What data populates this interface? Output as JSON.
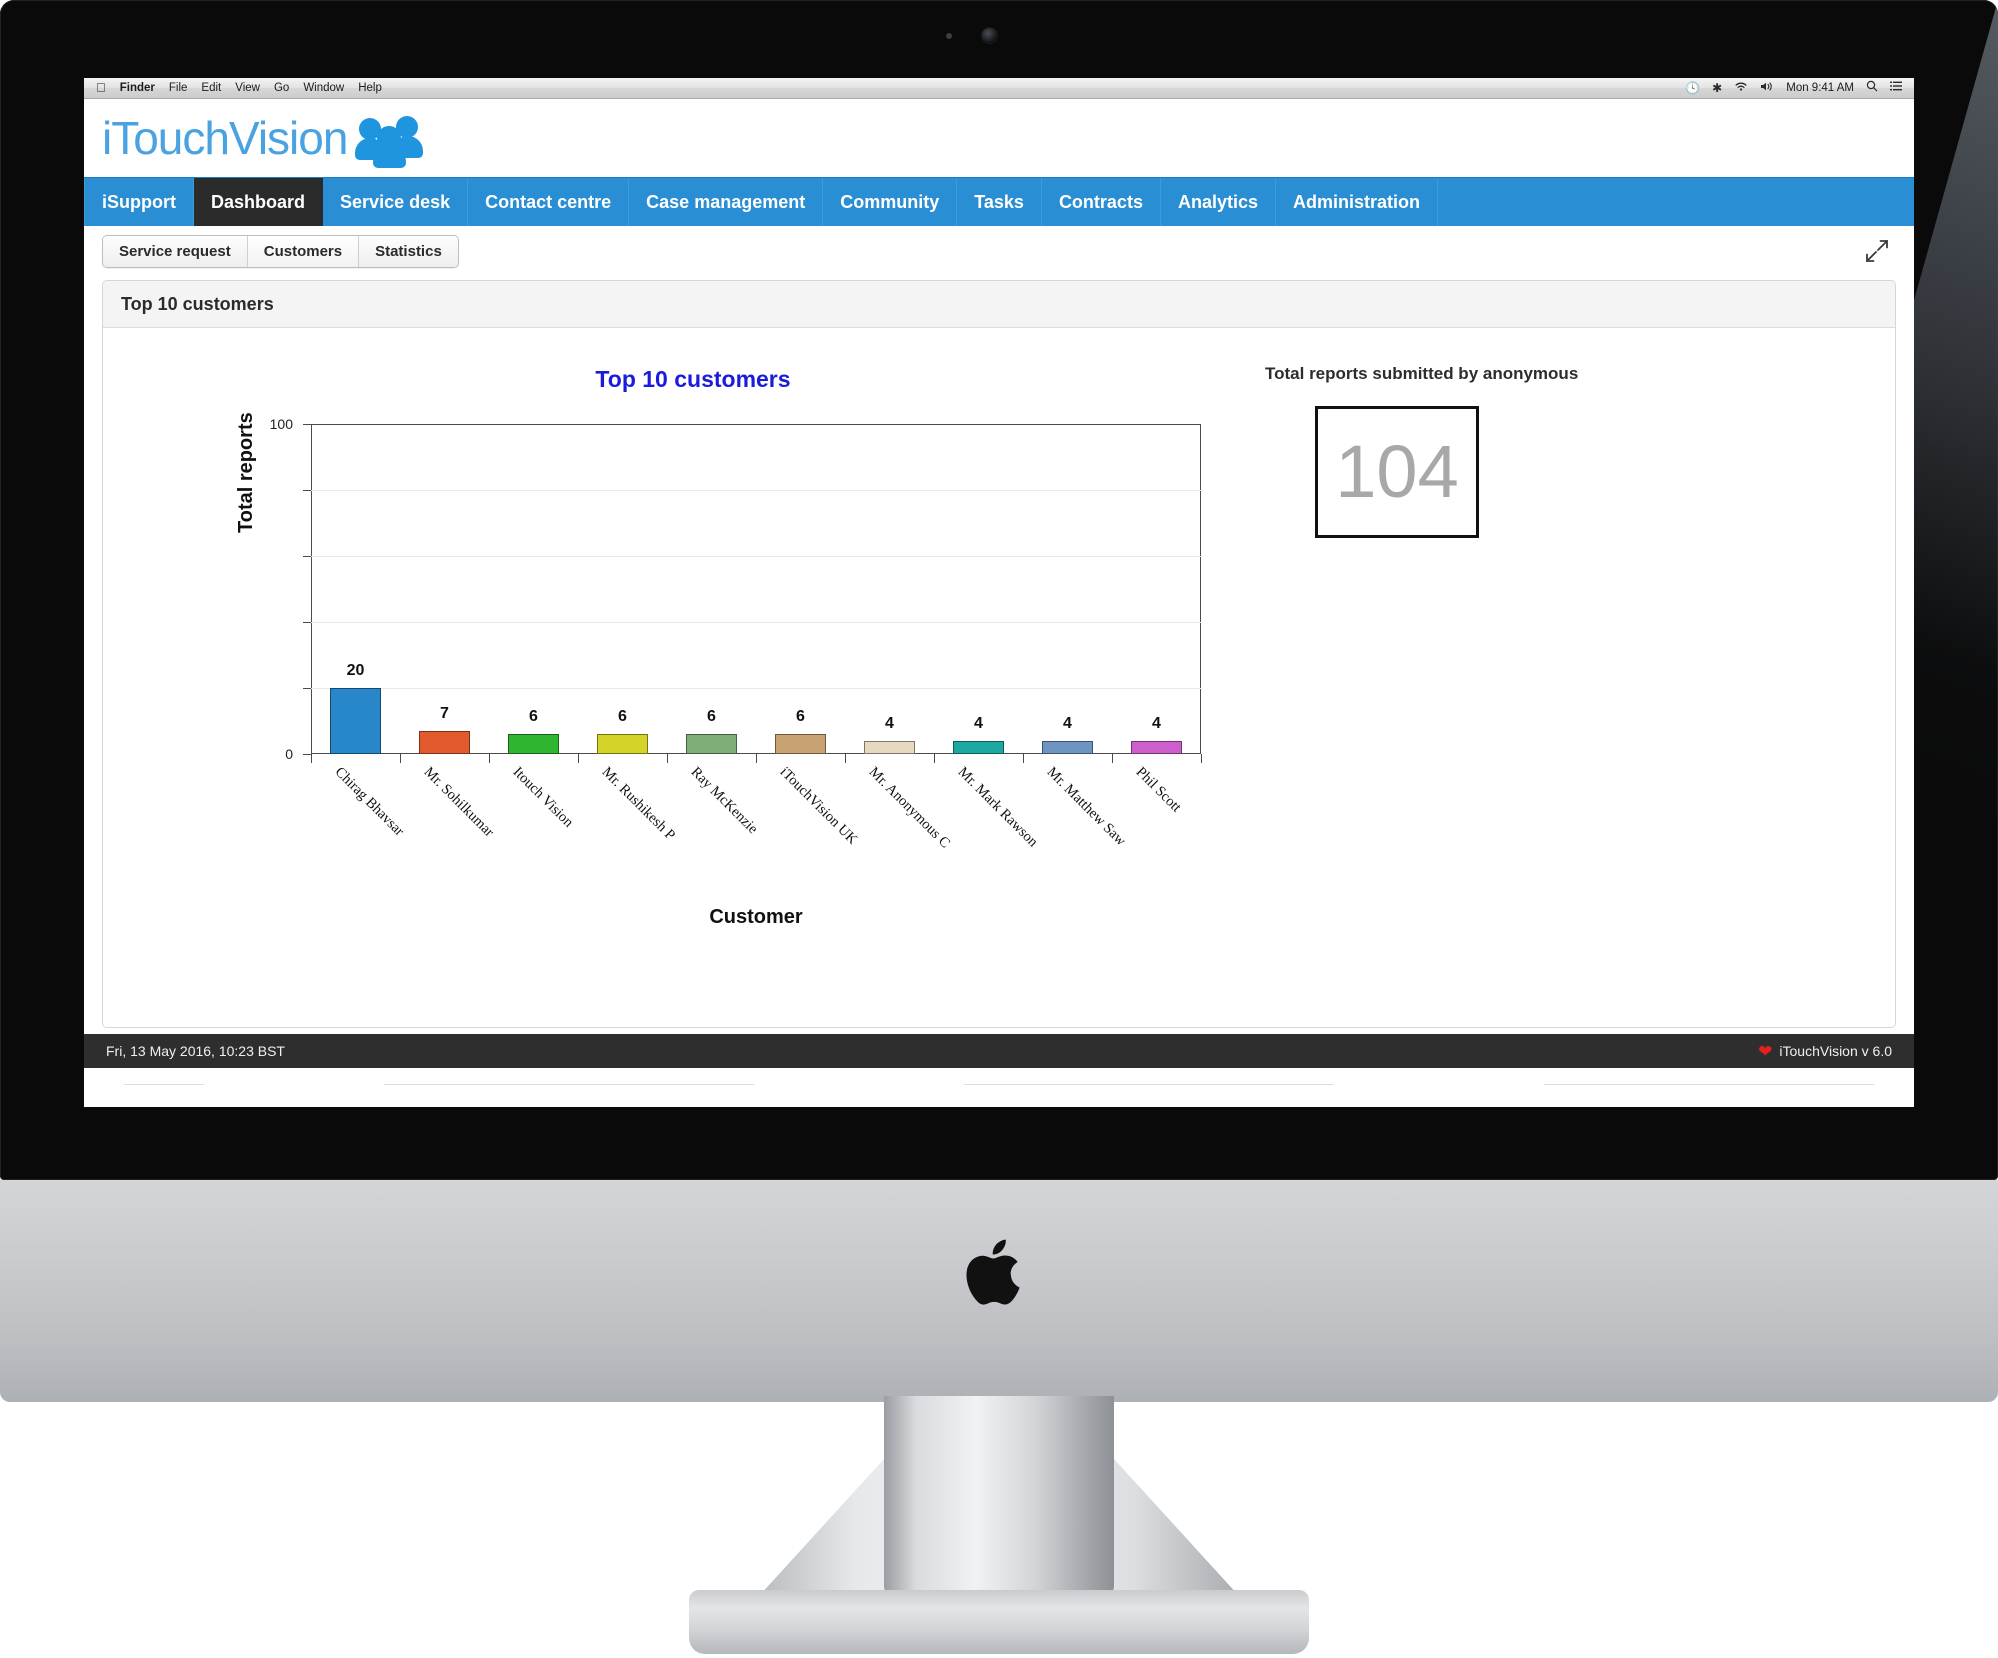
{
  "os": {
    "menubar": {
      "apple_glyph": "",
      "items": [
        "Finder",
        "File",
        "Edit",
        "View",
        "Go",
        "Window",
        "Help"
      ],
      "status_icons": [
        "timemachine-icon",
        "bluetooth-icon",
        "wifi-icon",
        "volume-icon"
      ],
      "clock": "Mon 9:41 AM",
      "search_icon": "search-icon",
      "notifications_icon": "notification-center-icon"
    }
  },
  "app": {
    "brand": "iTouchVision",
    "brand_color": "#4aa3e0",
    "nav": {
      "items": [
        {
          "label": "iSupport",
          "active": false
        },
        {
          "label": "Dashboard",
          "active": true
        },
        {
          "label": "Service desk",
          "active": false
        },
        {
          "label": "Contact centre",
          "active": false
        },
        {
          "label": "Case management",
          "active": false
        },
        {
          "label": "Community",
          "active": false
        },
        {
          "label": "Tasks",
          "active": false
        },
        {
          "label": "Contracts",
          "active": false
        },
        {
          "label": "Analytics",
          "active": false
        },
        {
          "label": "Administration",
          "active": false
        }
      ],
      "bg_color": "#2a8ed4",
      "active_bg_color": "#2b2b2b"
    },
    "subtabs": [
      {
        "label": "Service request",
        "active": false
      },
      {
        "label": "Customers",
        "active": true
      },
      {
        "label": "Statistics",
        "active": false
      }
    ],
    "expand_icon": "expand-fullscreen-icon",
    "panel": {
      "title": "Top 10 customers"
    },
    "kpi": {
      "title": "Total reports submitted by anonymous",
      "value": "104"
    },
    "footer": {
      "timestamp": "Fri, 13 May 2016, 10:23 BST",
      "heart_icon": "heart-icon",
      "version": "iTouchVision v 6.0",
      "heart_color": "#e8201c"
    }
  },
  "chart_data": {
    "type": "bar",
    "title": "Top 10 customers",
    "title_color": "#1b1bdd",
    "xlabel": "Customer",
    "ylabel": "Total reports",
    "ylim": [
      0,
      100
    ],
    "yticks": [
      0,
      20,
      40,
      60,
      80,
      100
    ],
    "ytick_labels": [
      "0",
      "",
      "",
      "",
      "",
      "100"
    ],
    "grid": true,
    "legend": "none",
    "categories": [
      "Chirag Bhavsar",
      "Mr. Sohilkumar",
      "Itouch Vision",
      "Mr. Rushikesh P",
      "Ray McKenzie",
      "iTouchVision UK",
      "Mr. Anonymous C",
      "Mr. Mark Rawson",
      "Mr. Matthew Saw",
      "Phil Scott"
    ],
    "values": [
      20,
      7,
      6,
      6,
      6,
      6,
      4,
      4,
      4,
      4
    ],
    "colors": [
      "#2787c8",
      "#e05a2b",
      "#2fb52f",
      "#d4d32a",
      "#7fae79",
      "#c9a273",
      "#e6d9bf",
      "#1ca8a0",
      "#6e95c1",
      "#cc5fcc"
    ]
  }
}
